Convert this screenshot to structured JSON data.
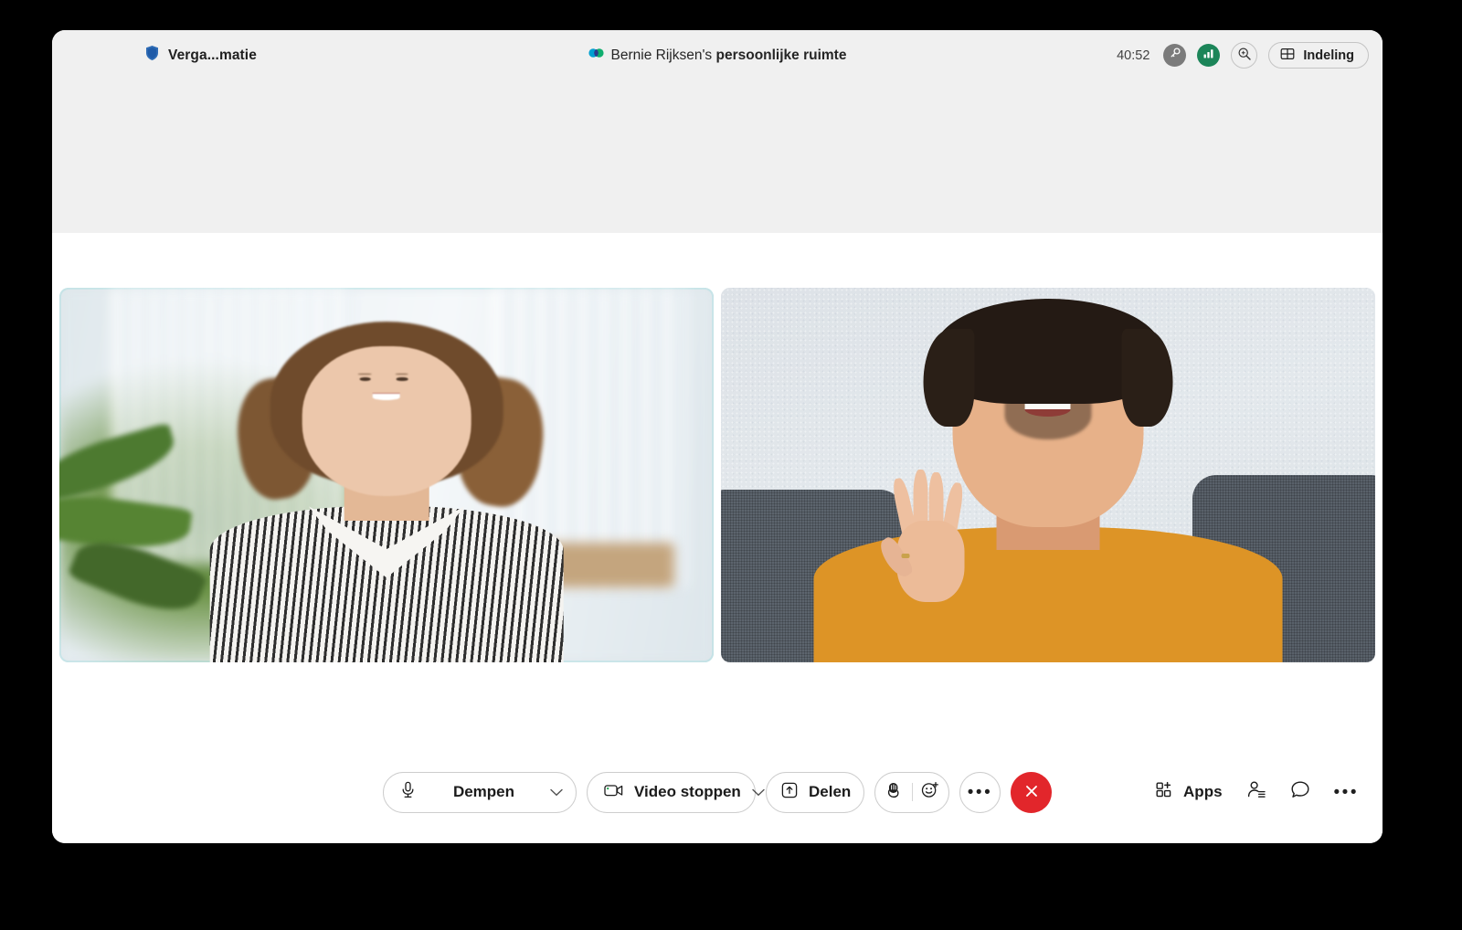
{
  "window": {
    "background_color": "#000000",
    "surface_color": "#ffffff",
    "header_color": "#f0f0f0"
  },
  "header": {
    "shield_icon": "shield-icon",
    "meeting_info_label": "Verga...matie",
    "room": {
      "icon": "webex-logo-icon",
      "owner": "Bernie Rijksen's",
      "space": "persoonlijke ruimte"
    },
    "timer": "40:52",
    "badges": [
      {
        "name": "encryption-key-badge",
        "icon": "key-icon",
        "color": "#7b7b7b"
      },
      {
        "name": "network-quality-badge",
        "icon": "signal-bars-icon",
        "color": "#1c8559"
      }
    ],
    "search_icon": "zoom-search-icon",
    "layout_button": {
      "label": "Indeling",
      "icon": "grid-layout-icon"
    }
  },
  "stage": {
    "tiles": [
      {
        "name": "video-tile-participant-1",
        "active_speaker": true,
        "border_color": "#a9dde0"
      },
      {
        "name": "video-tile-participant-2",
        "active_speaker": false
      }
    ]
  },
  "controls": {
    "mute": {
      "label": "Dempen",
      "icon": "microphone-icon",
      "chevron": "chevron-down-icon"
    },
    "video": {
      "label": "Video stoppen",
      "icon": "camera-icon",
      "chevron": "chevron-down-icon"
    },
    "share": {
      "label": "Delen",
      "icon": "share-screen-icon"
    },
    "raise_hand_icon": "raise-hand-icon",
    "reactions_icon": "smiley-plus-icon",
    "more_icon": "more-horizontal-icon",
    "end_call": {
      "icon": "close-x-icon",
      "color": "#e2262b"
    },
    "apps": {
      "label": "Apps",
      "icon": "apps-grid-plus-icon"
    },
    "participants_icon": "participants-list-icon",
    "chat_icon": "chat-bubble-icon",
    "more_options_icon": "more-horizontal-icon"
  }
}
